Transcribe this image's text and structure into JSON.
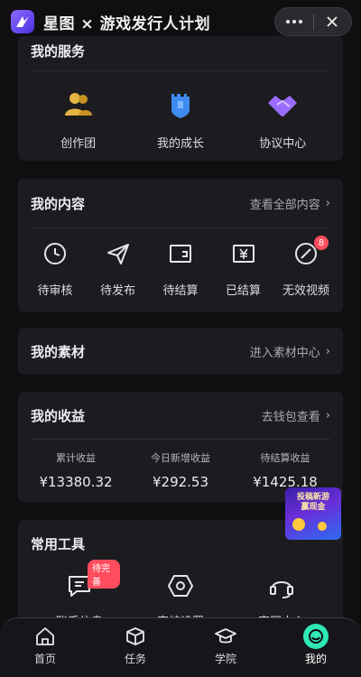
{
  "header": {
    "title": "星图 × 游戏发行人计划",
    "more_icon": "more-icon",
    "close_icon": "close-icon"
  },
  "services": {
    "title": "我的服务",
    "items": [
      {
        "label": "创作团",
        "icon": "people-icon",
        "color": "#e3b441"
      },
      {
        "label": "我的成长",
        "icon": "tower-shield-icon",
        "color": "#3f8cf0"
      },
      {
        "label": "协议中心",
        "icon": "handshake-icon",
        "color": "#9b6cff"
      }
    ]
  },
  "content": {
    "title": "我的内容",
    "link": "查看全部内容",
    "items": [
      {
        "label": "待审核",
        "icon": "clock-icon"
      },
      {
        "label": "待发布",
        "icon": "send-icon"
      },
      {
        "label": "待结算",
        "icon": "wallet-icon"
      },
      {
        "label": "已结算",
        "icon": "yen-icon"
      },
      {
        "label": "无效视频",
        "icon": "invalid-icon",
        "badge": "8"
      }
    ]
  },
  "material": {
    "title": "我的素材",
    "link": "进入素材中心"
  },
  "income": {
    "title": "我的收益",
    "link": "去钱包查看",
    "stats": [
      {
        "label": "累计收益",
        "value": "¥13380.32"
      },
      {
        "label": "今日新增收益",
        "value": "¥292.53"
      },
      {
        "label": "待结算收益",
        "value": "¥1425.18"
      }
    ]
  },
  "promo": {
    "text_line1": "投稿新游",
    "text_line2": "赢现金"
  },
  "tools": {
    "title": "常用工具",
    "items": [
      {
        "label": "联系信息",
        "icon": "message-icon",
        "tag": "待完善"
      },
      {
        "label": "审核设置",
        "icon": "hexagon-settings-icon"
      },
      {
        "label": "客服中心",
        "icon": "headset-icon"
      }
    ]
  },
  "tabbar": {
    "items": [
      {
        "label": "首页",
        "icon": "home-icon"
      },
      {
        "label": "任务",
        "icon": "box-icon"
      },
      {
        "label": "学院",
        "icon": "graduation-cap-icon"
      },
      {
        "label": "我的",
        "icon": "profile-icon",
        "active": true
      }
    ],
    "active_color": "#2ee8b6"
  },
  "colors": {
    "background": "#0f0f12",
    "card": "#1c1c20",
    "badge": "#ff4d5e"
  }
}
